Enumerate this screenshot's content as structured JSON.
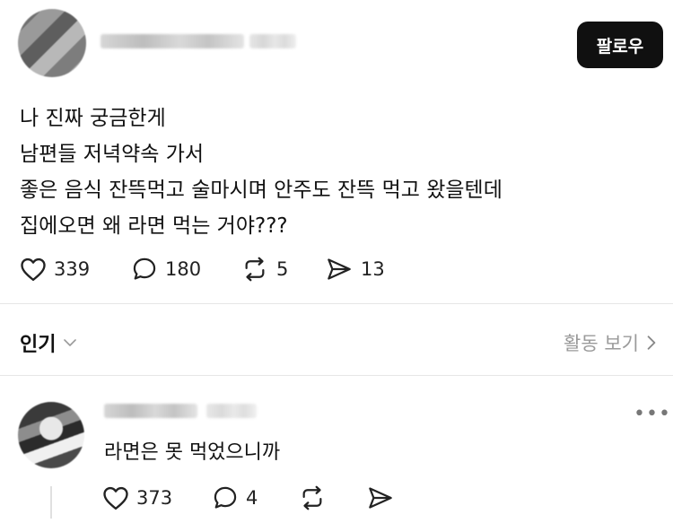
{
  "follow_button": "팔로우",
  "post": {
    "lines": [
      "나 진짜 궁금한게",
      "남편들 저녁약속 가서",
      "좋은 음식 잔뜩먹고 술마시며 안주도 잔뜩 먹고 왔을텐데",
      "집에오면 왜 라면 먹는 거야???"
    ],
    "likes": "339",
    "comments": "180",
    "reposts": "5",
    "shares": "13"
  },
  "tabs": {
    "popular": "인기",
    "view_activity": "활동 보기"
  },
  "reply": {
    "text": "라면은 못 먹었으니까",
    "likes": "373",
    "comments": "4"
  },
  "icons": [
    "heart-icon",
    "comment-icon",
    "repost-icon",
    "share-icon",
    "chevron-down-icon",
    "chevron-right-icon",
    "more-icon"
  ]
}
